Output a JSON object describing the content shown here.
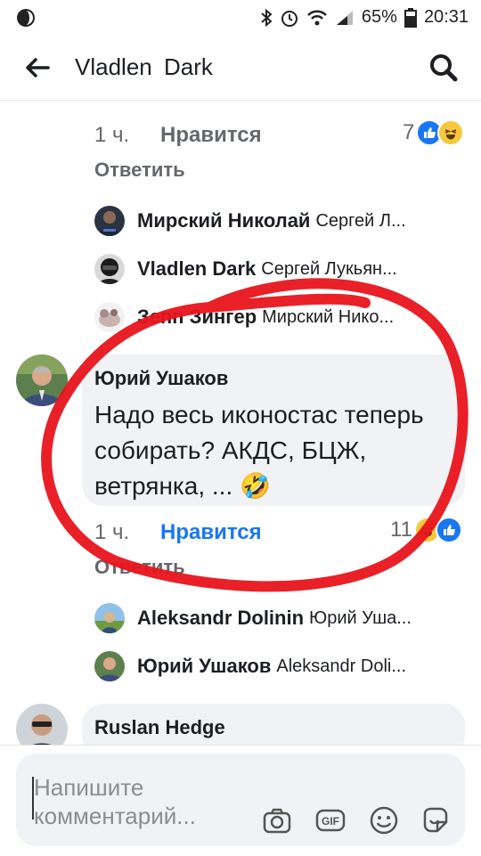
{
  "status_bar": {
    "battery": "65%",
    "time": "20:31"
  },
  "header": {
    "title": "Vladlen  Dark"
  },
  "thread1": {
    "time": "1 ч.",
    "like": "Нравится",
    "reaction_count": "7",
    "reply": "Ответить",
    "replies": [
      {
        "name": "Мирский Николай",
        "snippet": "Сергей Л..."
      },
      {
        "name": "Vladlen  Dark",
        "snippet": "Сергей Лукьян..."
      },
      {
        "name": "Зепп Зингер",
        "snippet": "Мирский Нико..."
      }
    ]
  },
  "comment": {
    "author": "Юрий Ушаков",
    "text": "Надо весь иконостас теперь собирать? АКДС, БЦЖ, ветрянка, ... 🤣",
    "time": "1 ч.",
    "like": "Нравится",
    "reaction_count": "11",
    "reply": "Ответить",
    "replies": [
      {
        "name": "Aleksandr Dolinin",
        "snippet": "Юрий Уша..."
      },
      {
        "name": "Юрий Ушаков",
        "snippet": "Aleksandr Doli..."
      }
    ]
  },
  "next_comment": {
    "author": "Ruslan Hedge"
  },
  "composer": {
    "placeholder": "Напишите комментарий..."
  },
  "colors": {
    "accent": "#1877f2",
    "annotation": "#e8141b",
    "bubble": "#f0f2f5"
  },
  "icons": [
    "back-arrow-icon",
    "search-icon",
    "camera-icon",
    "gif-icon",
    "emoji-icon",
    "sticker-icon"
  ]
}
